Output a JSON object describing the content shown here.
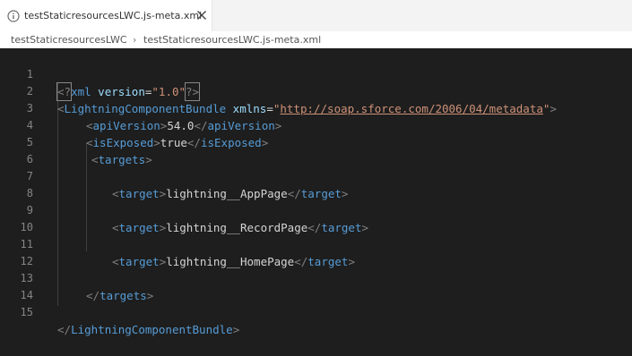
{
  "tab": {
    "title": "testStaticresourcesLWC.js-meta.xml",
    "info_icon": "info-circle-icon",
    "close_icon": "close-icon"
  },
  "breadcrumb": {
    "folder": "testStaticresourcesLWC",
    "separator": "›",
    "file": "testStaticresourcesLWC.js-meta.xml"
  },
  "editor": {
    "line_numbers": [
      "1",
      "2",
      "3",
      "4",
      "5",
      "6",
      "7",
      "8",
      "9",
      "10",
      "11",
      "12",
      "13",
      "14",
      "15"
    ],
    "code": {
      "l1_pi_open": "<?",
      "l1_name": "xml",
      "l1_attr": " version",
      "l1_eq": "=",
      "l1_val": "\"1.0\"",
      "l1_pi_close": "?>",
      "l2_lt": "<",
      "l2_tag": "LightningComponentBundle",
      "l2_attr": " xmlns",
      "l2_eq": "=",
      "l2_q1": "\"",
      "l2_url": "http://soap.sforce.com/2006/04/metadata",
      "l2_q2": "\"",
      "l2_gt": ">",
      "l3_lt": "<",
      "l3_tag": "apiVersion",
      "l3_gt": ">",
      "l3_text": "54.0",
      "l3_lt2": "</",
      "l3_tag2": "apiVersion",
      "l3_gt2": ">",
      "l4_lt": "<",
      "l4_tag": "isExposed",
      "l4_gt": ">",
      "l4_text": "true",
      "l4_lt2": "</",
      "l4_tag2": "isExposed",
      "l4_gt2": ">",
      "l5_lt": "<",
      "l5_tag": "targets",
      "l5_gt": ">",
      "l7_lt": "<",
      "l7_tag": "target",
      "l7_gt": ">",
      "l7_text": "lightning__AppPage",
      "l7_lt2": "</",
      "l7_tag2": "target",
      "l7_gt2": ">",
      "l9_lt": "<",
      "l9_tag": "target",
      "l9_gt": ">",
      "l9_text": "lightning__RecordPage",
      "l9_lt2": "</",
      "l9_tag2": "target",
      "l9_gt2": ">",
      "l11_lt": "<",
      "l11_tag": "target",
      "l11_gt": ">",
      "l11_text": "lightning__HomePage",
      "l11_lt2": "</",
      "l11_tag2": "target",
      "l11_gt2": ">",
      "l13_lt": "</",
      "l13_tag": "targets",
      "l13_gt": ">",
      "l15_lt": "</",
      "l15_tag": "LightningComponentBundle",
      "l15_gt": ">"
    }
  },
  "colors": {
    "editor_bg": "#1e1e1e",
    "tag": "#569cd6",
    "attribute": "#9cdcfe",
    "string": "#ce9178",
    "text": "#d4d4d4",
    "punctuation": "#808080",
    "line_number": "#858585"
  }
}
